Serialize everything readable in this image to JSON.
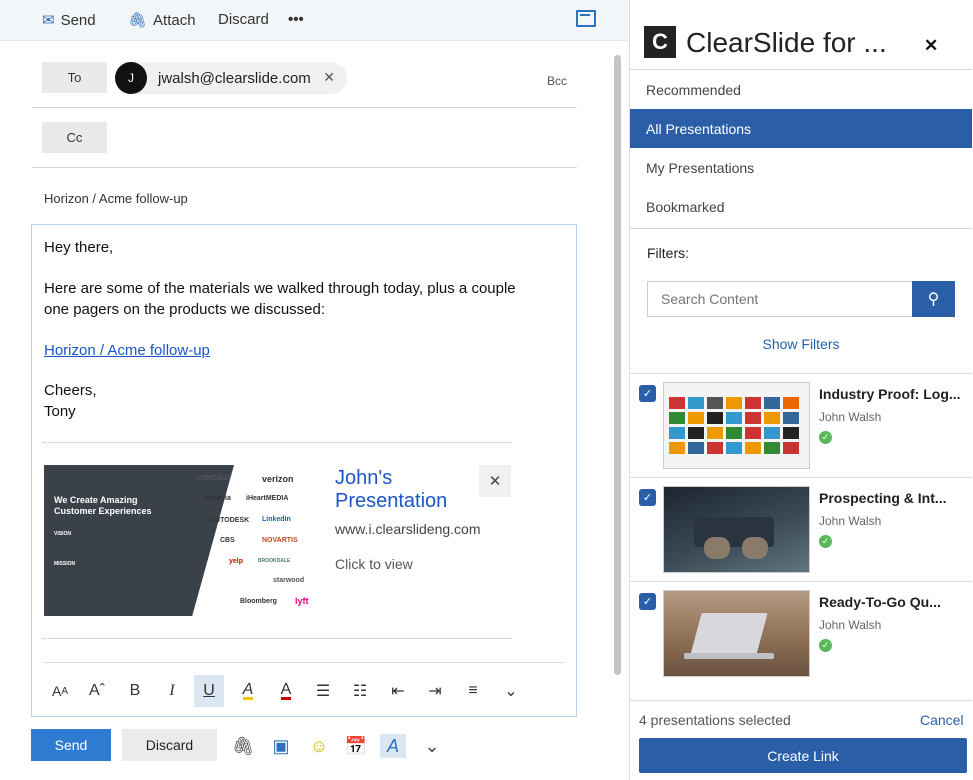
{
  "toolbar": {
    "send": "Send",
    "attach": "Attach",
    "discard": "Discard",
    "more": "•••"
  },
  "recipients": {
    "to_label": "To",
    "cc_label": "Cc",
    "bcc_label": "Bcc",
    "to_chip": {
      "initial": "J",
      "email": "jwalsh@clearslide.com"
    }
  },
  "subject": "Horizon / Acme follow-up",
  "body": {
    "greeting": "Hey there,",
    "para1_line1": "Here are some of the materials we walked through today, plus a couple",
    "para1_line2": "one pagers on the products we discussed:",
    "link": "Horizon / Acme follow-up",
    "signoff": "Cheers,",
    "signature": "Tony"
  },
  "card": {
    "title_line1": "John's",
    "title_line2": "Presentation",
    "url": "www.i.clearslideng.com",
    "cta": "Click to view",
    "thumb_heading_line1": "We Create Amazing",
    "thumb_heading_line2": "Customer Experiences",
    "thumb_vision": "VISION",
    "thumb_mission": "MISSION",
    "logos": [
      "COMCAST",
      "verizon",
      "Expedia",
      "iHeartMEDIA",
      "AUTODESK",
      "LinkedIn",
      "CBS",
      "NOVARTIS",
      "yelp",
      "BROOKDALE",
      "starwood",
      "Bloomberg",
      "lyft"
    ]
  },
  "bottom": {
    "send": "Send",
    "discard": "Discard"
  },
  "addin": {
    "title": "ClearSlide for ...",
    "logo_letter": "C",
    "nav": [
      "Recommended",
      "All Presentations",
      "My Presentations",
      "Bookmarked"
    ],
    "active_nav": "All Presentations",
    "filters_label": "Filters:",
    "search_placeholder": "Search Content",
    "show_filters": "Show Filters",
    "presentations": [
      {
        "title": "Industry Proof: Log...",
        "author": "John Walsh",
        "checked": true
      },
      {
        "title": "Prospecting & Int...",
        "author": "John Walsh",
        "checked": true
      },
      {
        "title": "Ready-To-Go Qu...",
        "author": "John Walsh",
        "checked": true
      }
    ],
    "selected_count": "4 presentations selected",
    "cancel": "Cancel",
    "create_link": "Create Link"
  },
  "colors": {
    "accent": "#2a5fa8",
    "send": "#2f7bd2",
    "link": "#1a55c9"
  }
}
